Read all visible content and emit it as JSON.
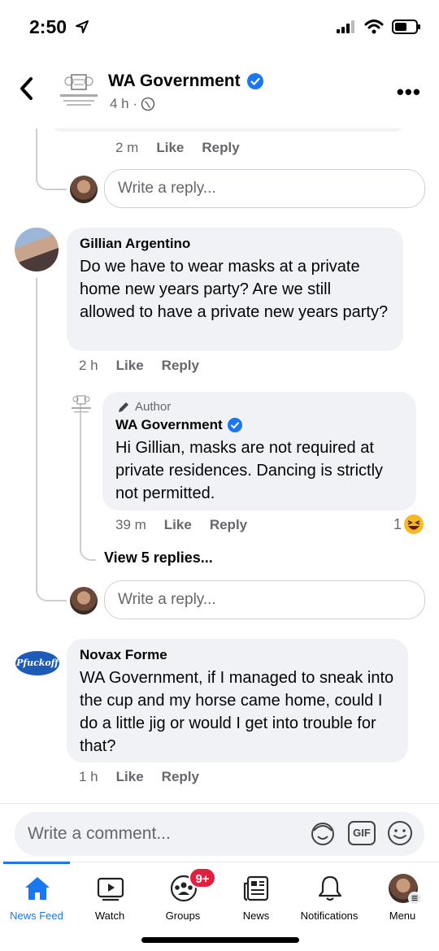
{
  "status": {
    "time": "2:50"
  },
  "header": {
    "title": "WA Government",
    "meta": "4 h ·"
  },
  "prev_reply": {
    "time": "2 m",
    "like": "Like",
    "reply": "Reply"
  },
  "reply_box_1": {
    "placeholder": "Write a reply..."
  },
  "comment_gillian": {
    "name": "Gillian Argentino",
    "text": "Do we have to wear masks at a private home new years party?  Are we still allowed to have a private new years party?",
    "time": "2 h",
    "like": "Like",
    "reply": "Reply"
  },
  "reply_wa": {
    "author_badge": "Author",
    "name": "WA Government",
    "text": "Hi Gillian, masks are not required at private residences. Dancing is strictly not permitted.",
    "time": "39 m",
    "like": "Like",
    "reply": "Reply",
    "reaction_count": "1"
  },
  "view_replies": "View 5 replies...",
  "reply_box_2": {
    "placeholder": "Write a reply..."
  },
  "comment_novax": {
    "avatar_text": "Pfuckoff",
    "name": "Novax Forme",
    "text": "WA Government, if I managed to sneak into the cup and my horse came home, could I do a little jig or would I get into trouble for that?",
    "time": "1 h",
    "like": "Like",
    "reply": "Reply"
  },
  "composer": {
    "placeholder": "Write a comment...",
    "gif": "GIF"
  },
  "tabs": [
    {
      "label": "News Feed",
      "icon": "home-icon"
    },
    {
      "label": "Watch",
      "icon": "watch-icon"
    },
    {
      "label": "Groups",
      "icon": "groups-icon",
      "badge": "9+"
    },
    {
      "label": "News",
      "icon": "news-icon"
    },
    {
      "label": "Notifications",
      "icon": "bell-icon"
    },
    {
      "label": "Menu",
      "icon": "menu-avatar-icon"
    }
  ],
  "colors": {
    "accent": "#1877f2",
    "bubble": "#f0f2f5",
    "muted": "#65676b",
    "badge": "#e41e3f"
  }
}
